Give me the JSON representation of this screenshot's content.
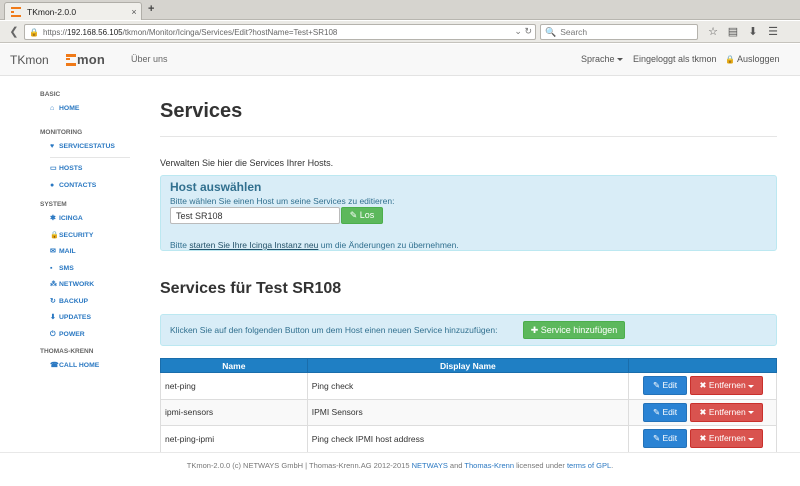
{
  "browser": {
    "tab_title": "TKmon-2.0.0",
    "url_prefix": "https://",
    "url_host": "192.168.56.105",
    "url_path": "/tkmon/Monitor/Icinga/Services/Edit?hostName=Test+SR108",
    "search_placeholder": "Search",
    "tab_close_glyph": "×",
    "new_tab_glyph": "+",
    "back_glyph": "❮",
    "url_info_glyph": "🔒",
    "url_ctrl_glyph": "⌄ ↻",
    "search_glyph": "🔍",
    "icons": {
      "star": "☆",
      "bookmarks": "▤",
      "download": "⬇",
      "menu": "☰"
    }
  },
  "header": {
    "brand": "TKmon",
    "logo_text": "mon",
    "about": "Über uns",
    "language": "Sprache",
    "logged_in": "Eingeloggt als tkmon",
    "logout": "Ausloggen",
    "lock_glyph": "🔒"
  },
  "sidebar": {
    "basic_label": "BASIC",
    "home": "HOME",
    "monitoring_label": "MONITORING",
    "servicestatus": "SERVICESTATUS",
    "hosts": "HOSTS",
    "contacts": "CONTACTS",
    "system_label": "SYSTEM",
    "icinga": "ICINGA",
    "security": "SECURITY",
    "mail": "MAIL",
    "sms": "SMS",
    "network": "NETWORK",
    "backup": "BACKUP",
    "updates": "UPDATES",
    "power": "POWER",
    "thomas_label": "THOMAS-KRENN",
    "callhome": "CALL HOME",
    "icons": {
      "home": "⌂",
      "servicestatus": "♥",
      "hosts": "▭",
      "contacts": "●",
      "icinga": "✱",
      "security": "🔒",
      "mail": "✉",
      "sms": "▪",
      "network": "⁂",
      "backup": "↻",
      "updates": "⬇",
      "power": "⏻",
      "callhome": "☎"
    }
  },
  "main": {
    "title": "Services",
    "intro": "Verwalten Sie hier die Services Ihrer Hosts.",
    "host_heading": "Host auswählen",
    "host_sub": "Bitte wählen Sie einen Host um seine Services zu editieren:",
    "host_value": "Test SR108",
    "los_button": "Los",
    "pencil_glyph": "✎",
    "restart_prefix": "Bitte ",
    "restart_link": "starten Sie Ihre Icinga Instanz neu",
    "restart_suffix": " um die Änderungen zu übernehmen.",
    "services_title": "Services für Test SR108",
    "add_text": "Klicken Sie auf den folgenden Button um dem Host einen neuen Service hinzuzufügen:",
    "add_button": "Service hinzufügen",
    "plus_glyph": "✚",
    "table": {
      "headers": [
        "Name",
        "Display Name",
        ""
      ],
      "rows": [
        {
          "name": "net-ping",
          "display": "Ping check"
        },
        {
          "name": "ipmi-sensors",
          "display": "IPMI Sensors"
        },
        {
          "name": "net-ping-ipmi",
          "display": "Ping check IPMI host address"
        }
      ],
      "edit_label": "Edit",
      "edit_glyph": "✎",
      "delete_label": "Entfernen",
      "delete_glyph": "✖"
    }
  },
  "footer": {
    "text1": "TKmon-2.0.0 (c) NETWAYS GmbH | Thomas-Krenn.AG 2012-2015 ",
    "link1": "NETWAYS",
    "text2": " and ",
    "link2": "Thomas-Krenn",
    "text3": " licensed under ",
    "link3": "terms of GPL",
    "text4": "."
  },
  "colors": {
    "accent": "#2a78c2",
    "logo_orange": "#f07a18",
    "info_bg": "#d9edf7",
    "success": "#5cb85c",
    "danger": "#d9534f",
    "table_header": "#1f7fc4"
  }
}
